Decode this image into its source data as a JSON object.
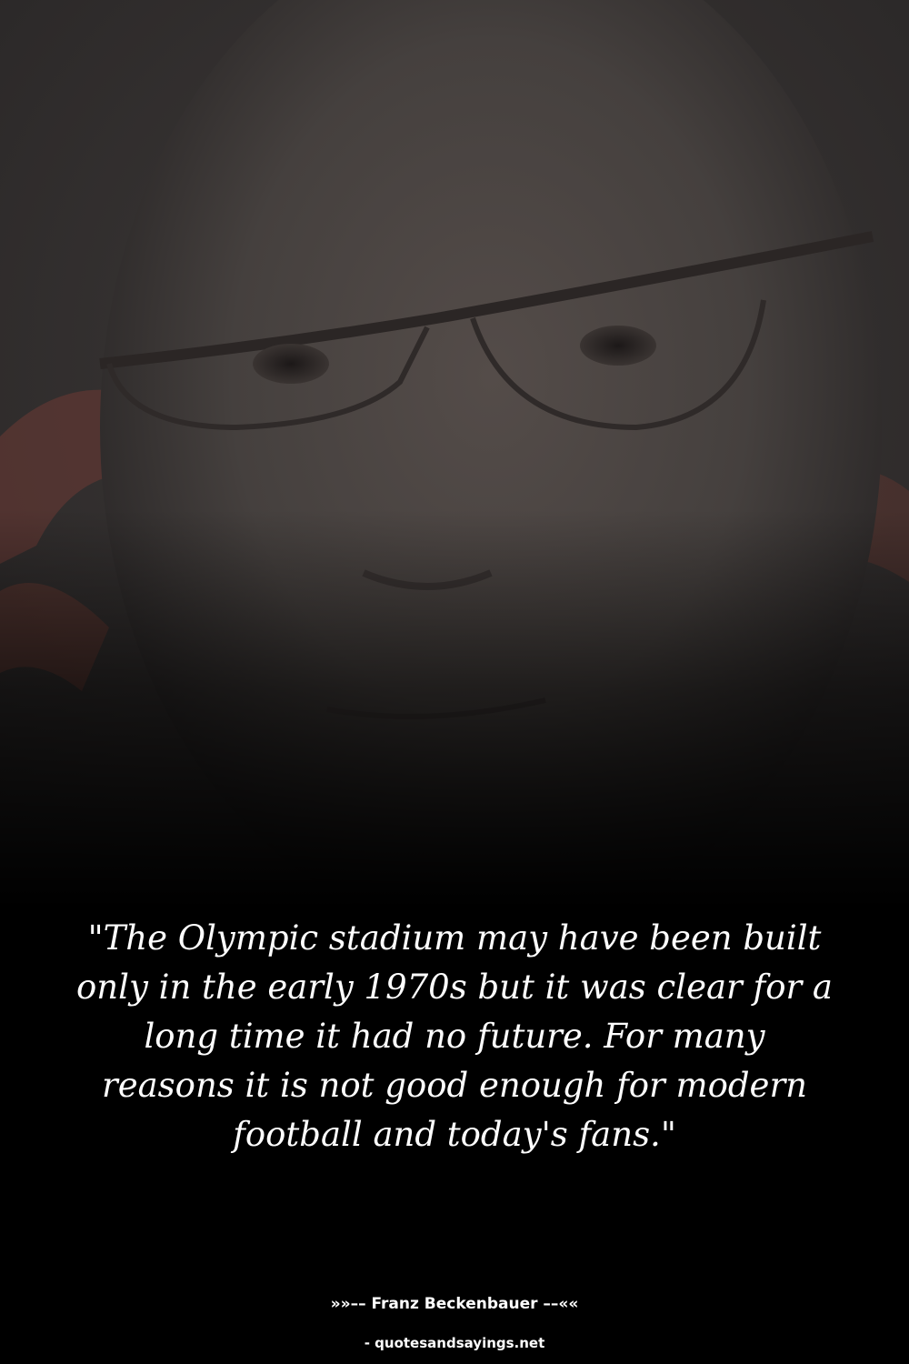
{
  "quote": {
    "text": "\"The Olympic stadium may have been built only in the early 1970s but it was clear for a long time it had no future. For many reasons it is not good enough for modern football and today's fans.\""
  },
  "attribution": {
    "author_line": "»»–– Franz Beckenbauer ––««"
  },
  "footer": {
    "site": "- quotesandsayings.net"
  },
  "colors": {
    "background": "#000000",
    "text": "#ffffff",
    "photo_tone": "#4a4442",
    "accent_red": "#6e3a34"
  },
  "image": {
    "subject": "portrait-photo"
  }
}
